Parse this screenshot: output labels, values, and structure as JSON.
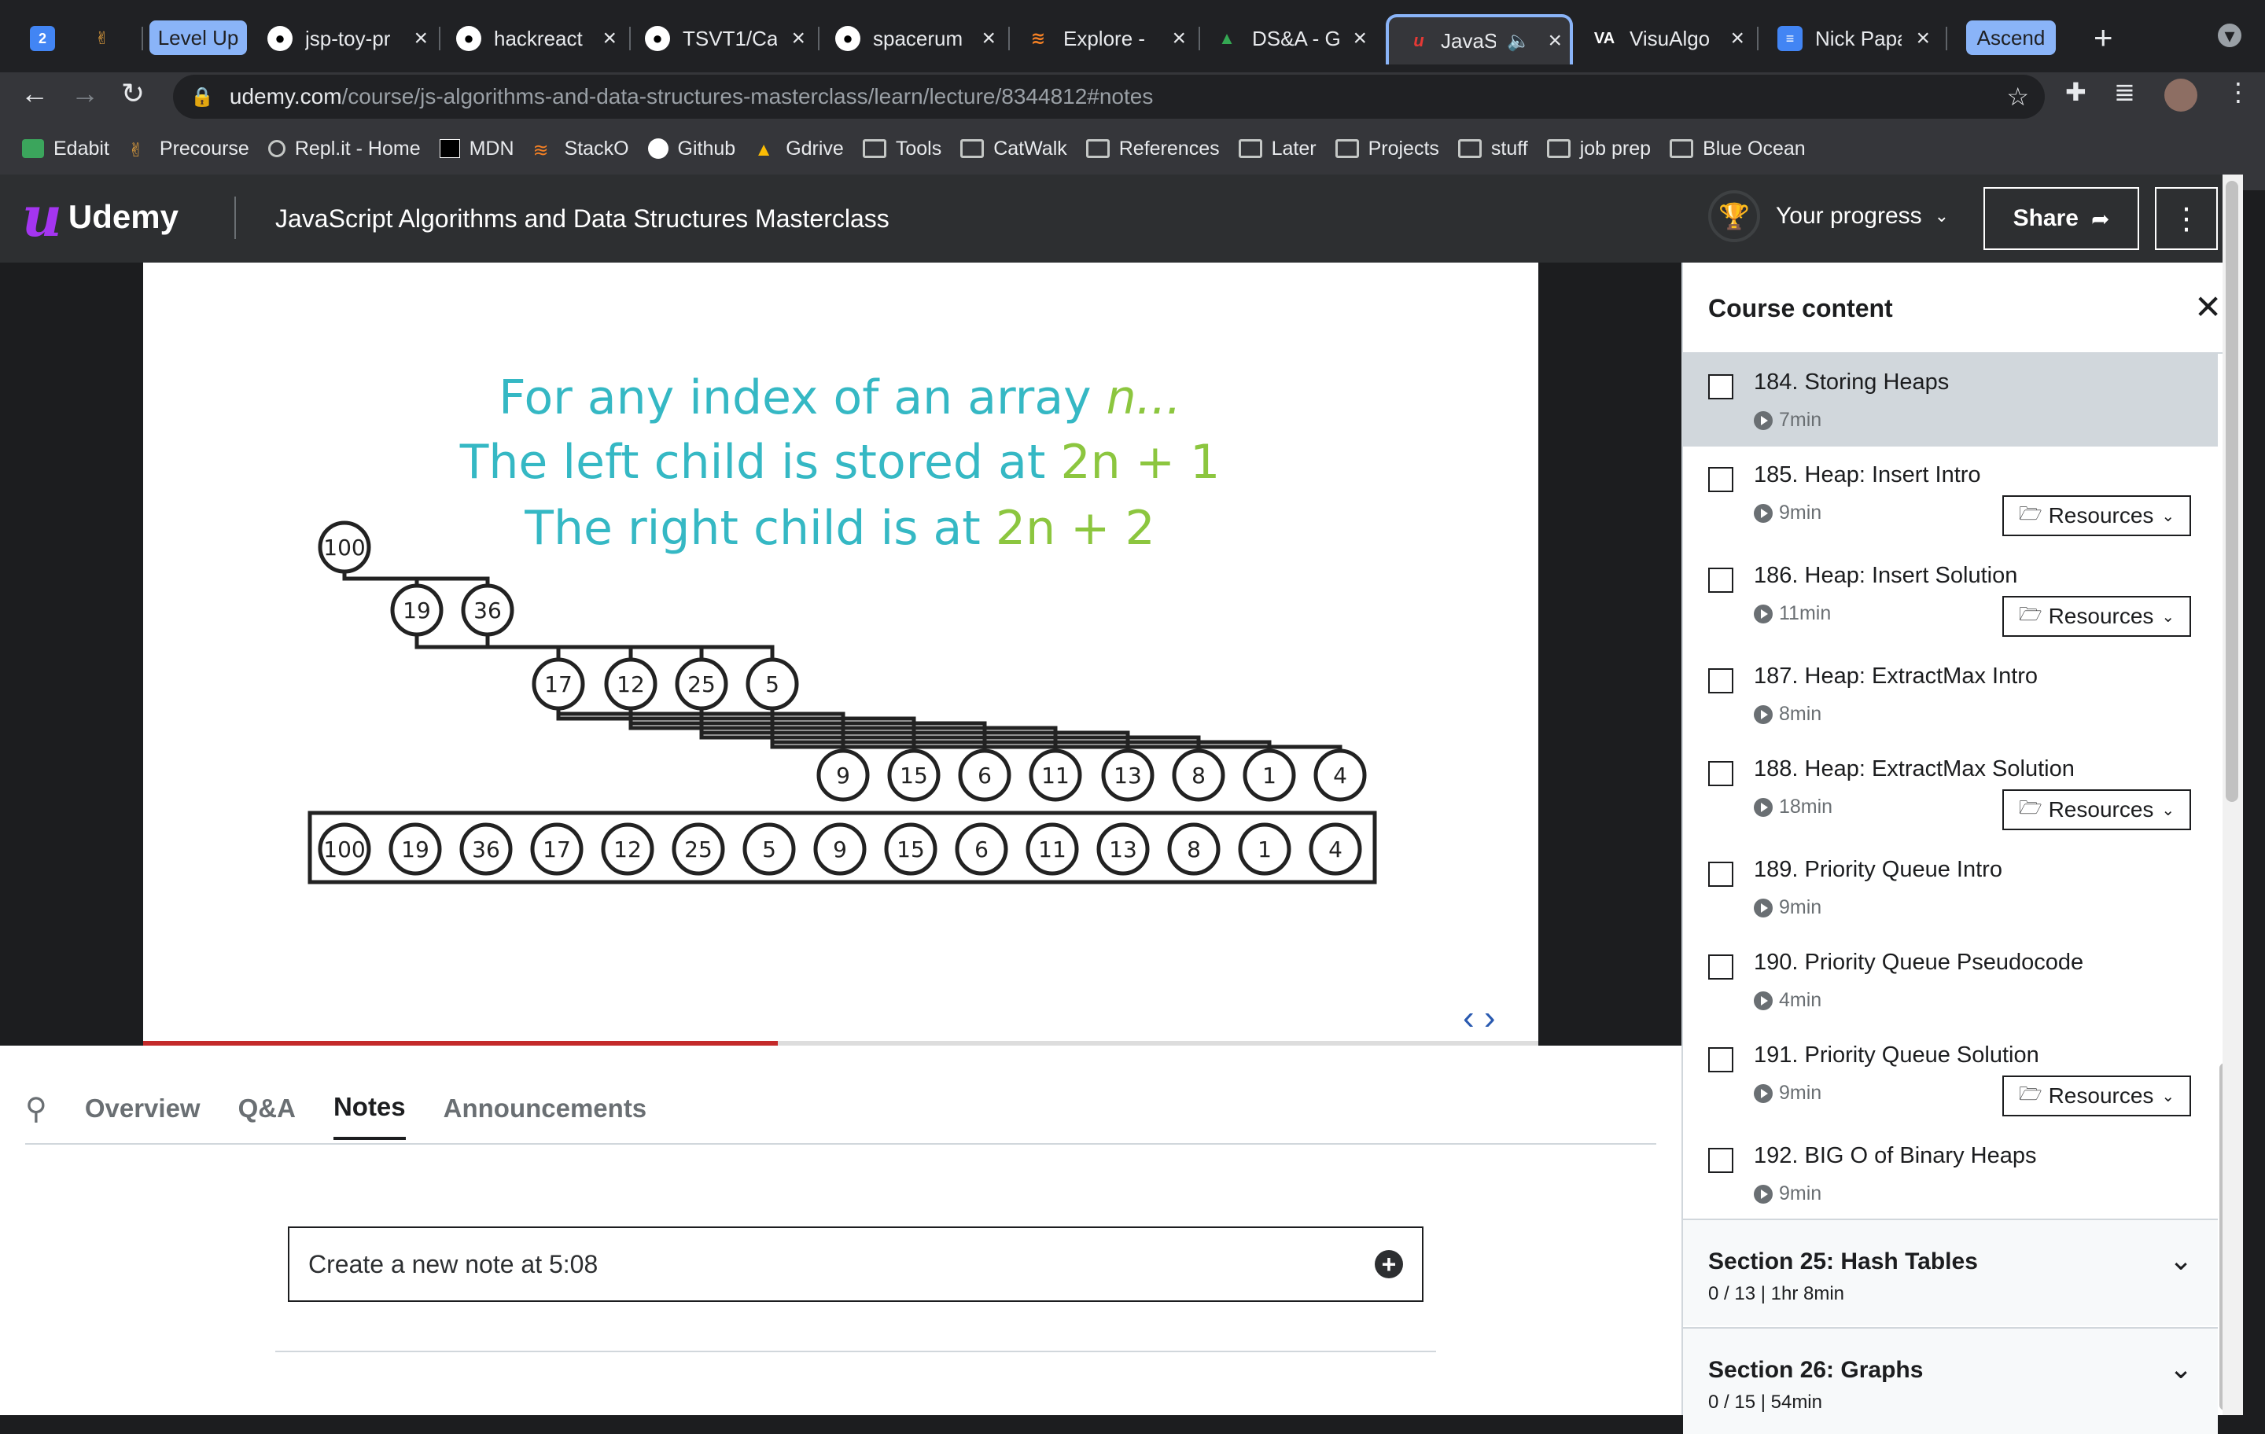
{
  "browser": {
    "tabs": [
      {
        "title": "",
        "favicon": "calendar-icon"
      },
      {
        "title": "",
        "favicon": "hand-icon"
      },
      {
        "title": "Level Up",
        "favicon": "group-pill"
      },
      {
        "title": "jsp-toy-pr",
        "favicon": "github-icon"
      },
      {
        "title": "hackreact",
        "favicon": "github-icon"
      },
      {
        "title": "TSVT1/Ca",
        "favicon": "github-icon"
      },
      {
        "title": "spacerum",
        "favicon": "github-icon"
      },
      {
        "title": "Explore -",
        "favicon": "stack-icon"
      },
      {
        "title": "DS&A - G",
        "favicon": "drive-icon"
      },
      {
        "title": "JavaS",
        "favicon": "udemy-icon",
        "active": true
      },
      {
        "title": "VisuAlgo",
        "favicon": "visualgo-icon"
      },
      {
        "title": "Nick Papa",
        "favicon": "doc-icon"
      },
      {
        "title": "Ascend",
        "favicon": "group-pill"
      }
    ],
    "url_host": "udemy.com",
    "url_path": "/course/js-algorithms-and-data-structures-masterclass/learn/lecture/8344812#notes",
    "bookmarks": [
      "Edabit",
      "Precourse",
      "Repl.it - Home",
      "MDN",
      "StackO",
      "Github",
      "Gdrive",
      "Tools",
      "CatWalk",
      "References",
      "Later",
      "Projects",
      "stuff",
      "job prep",
      "Blue Ocean"
    ]
  },
  "header": {
    "logo": "Udemy",
    "course_title": "JavaScript Algorithms and Data Structures Masterclass",
    "progress_label": "Your progress",
    "share_label": "Share"
  },
  "slide": {
    "line1_prefix": "For any index of an array ",
    "line1_var": "n...",
    "line2_prefix": "The left child is stored at ",
    "line2_expr": "2n + 1",
    "line3_prefix": "The right child is at ",
    "line3_expr": "2n + 2",
    "tree_levels": [
      [
        "100"
      ],
      [
        "19",
        "36"
      ],
      [
        "17",
        "12",
        "25",
        "5"
      ],
      [
        "9",
        "15",
        "6",
        "11",
        "13",
        "8",
        "1",
        "4"
      ]
    ],
    "array": [
      "100",
      "19",
      "36",
      "17",
      "12",
      "25",
      "5",
      "9",
      "15",
      "6",
      "11",
      "13",
      "8",
      "1",
      "4"
    ],
    "video_progress": 0.455
  },
  "lower_tabs": {
    "items": [
      "Overview",
      "Q&A",
      "Notes",
      "Announcements"
    ],
    "active": "Notes",
    "note_placeholder": "Create a new note at 5:08"
  },
  "sidebar": {
    "title": "Course content",
    "lessons": [
      {
        "title": "184. Storing Heaps",
        "duration": "7min",
        "resources": false,
        "current": true
      },
      {
        "title": "185. Heap: Insert Intro",
        "duration": "9min",
        "resources": true
      },
      {
        "title": "186. Heap: Insert Solution",
        "duration": "11min",
        "resources": true
      },
      {
        "title": "187. Heap: ExtractMax Intro",
        "duration": "8min",
        "resources": false
      },
      {
        "title": "188. Heap: ExtractMax Solution",
        "duration": "18min",
        "resources": true
      },
      {
        "title": "189. Priority Queue Intro",
        "duration": "9min",
        "resources": false
      },
      {
        "title": "190. Priority Queue Pseudocode",
        "duration": "4min",
        "resources": false
      },
      {
        "title": "191. Priority Queue Solution",
        "duration": "9min",
        "resources": true
      },
      {
        "title": "192. BIG O of Binary Heaps",
        "duration": "9min",
        "resources": false
      }
    ],
    "resources_label": "Resources",
    "sections": [
      {
        "title": "Section 25: Hash Tables",
        "meta": "0 / 13 | 1hr 8min"
      },
      {
        "title": "Section 26: Graphs",
        "meta": "0 / 15 | 54min"
      }
    ]
  }
}
